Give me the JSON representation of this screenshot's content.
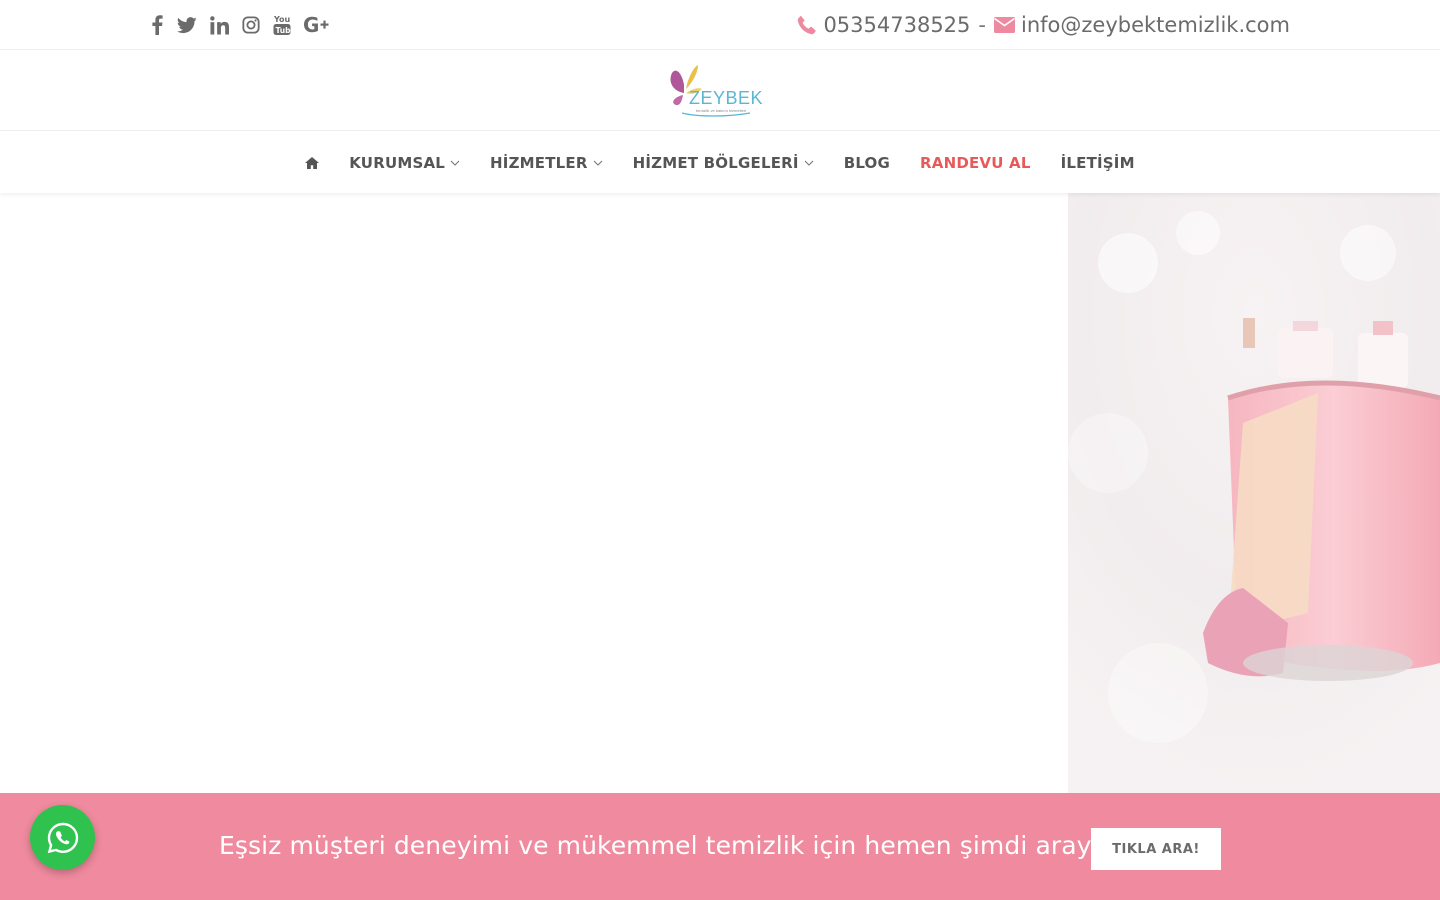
{
  "topbar": {
    "social_icons": [
      "facebook-icon",
      "twitter-icon",
      "linkedin-icon",
      "instagram-icon",
      "youtube-icon",
      "google-plus-icon"
    ],
    "phone": "05354738525",
    "separator": "-",
    "email": "info@zeybektemizlik.com"
  },
  "logo": {
    "name": "ZEYBEK",
    "tagline": "temizlik ve bakımı hizmetleri"
  },
  "nav": {
    "home_icon": "home-icon",
    "items": [
      {
        "label": "KURUMSAL",
        "dropdown": true
      },
      {
        "label": "HİZMETLER",
        "dropdown": true
      },
      {
        "label": "HİZMET BÖLGELERİ",
        "dropdown": true
      },
      {
        "label": "BLOG",
        "dropdown": false
      },
      {
        "label": "RANDEVU AL",
        "dropdown": false
      },
      {
        "label": "İLETİŞİM",
        "dropdown": false
      }
    ]
  },
  "cta": {
    "text": "Eşsiz müşteri deneyimi ve mükemmel temizlik için hemen şimdi arayın.",
    "button": "TIKLA ARA!"
  },
  "colors": {
    "accent": "#e85a5a",
    "brand_pink": "#f08a9e",
    "whatsapp": "#2fc24f",
    "icon_pink": "#ee8aa0"
  }
}
